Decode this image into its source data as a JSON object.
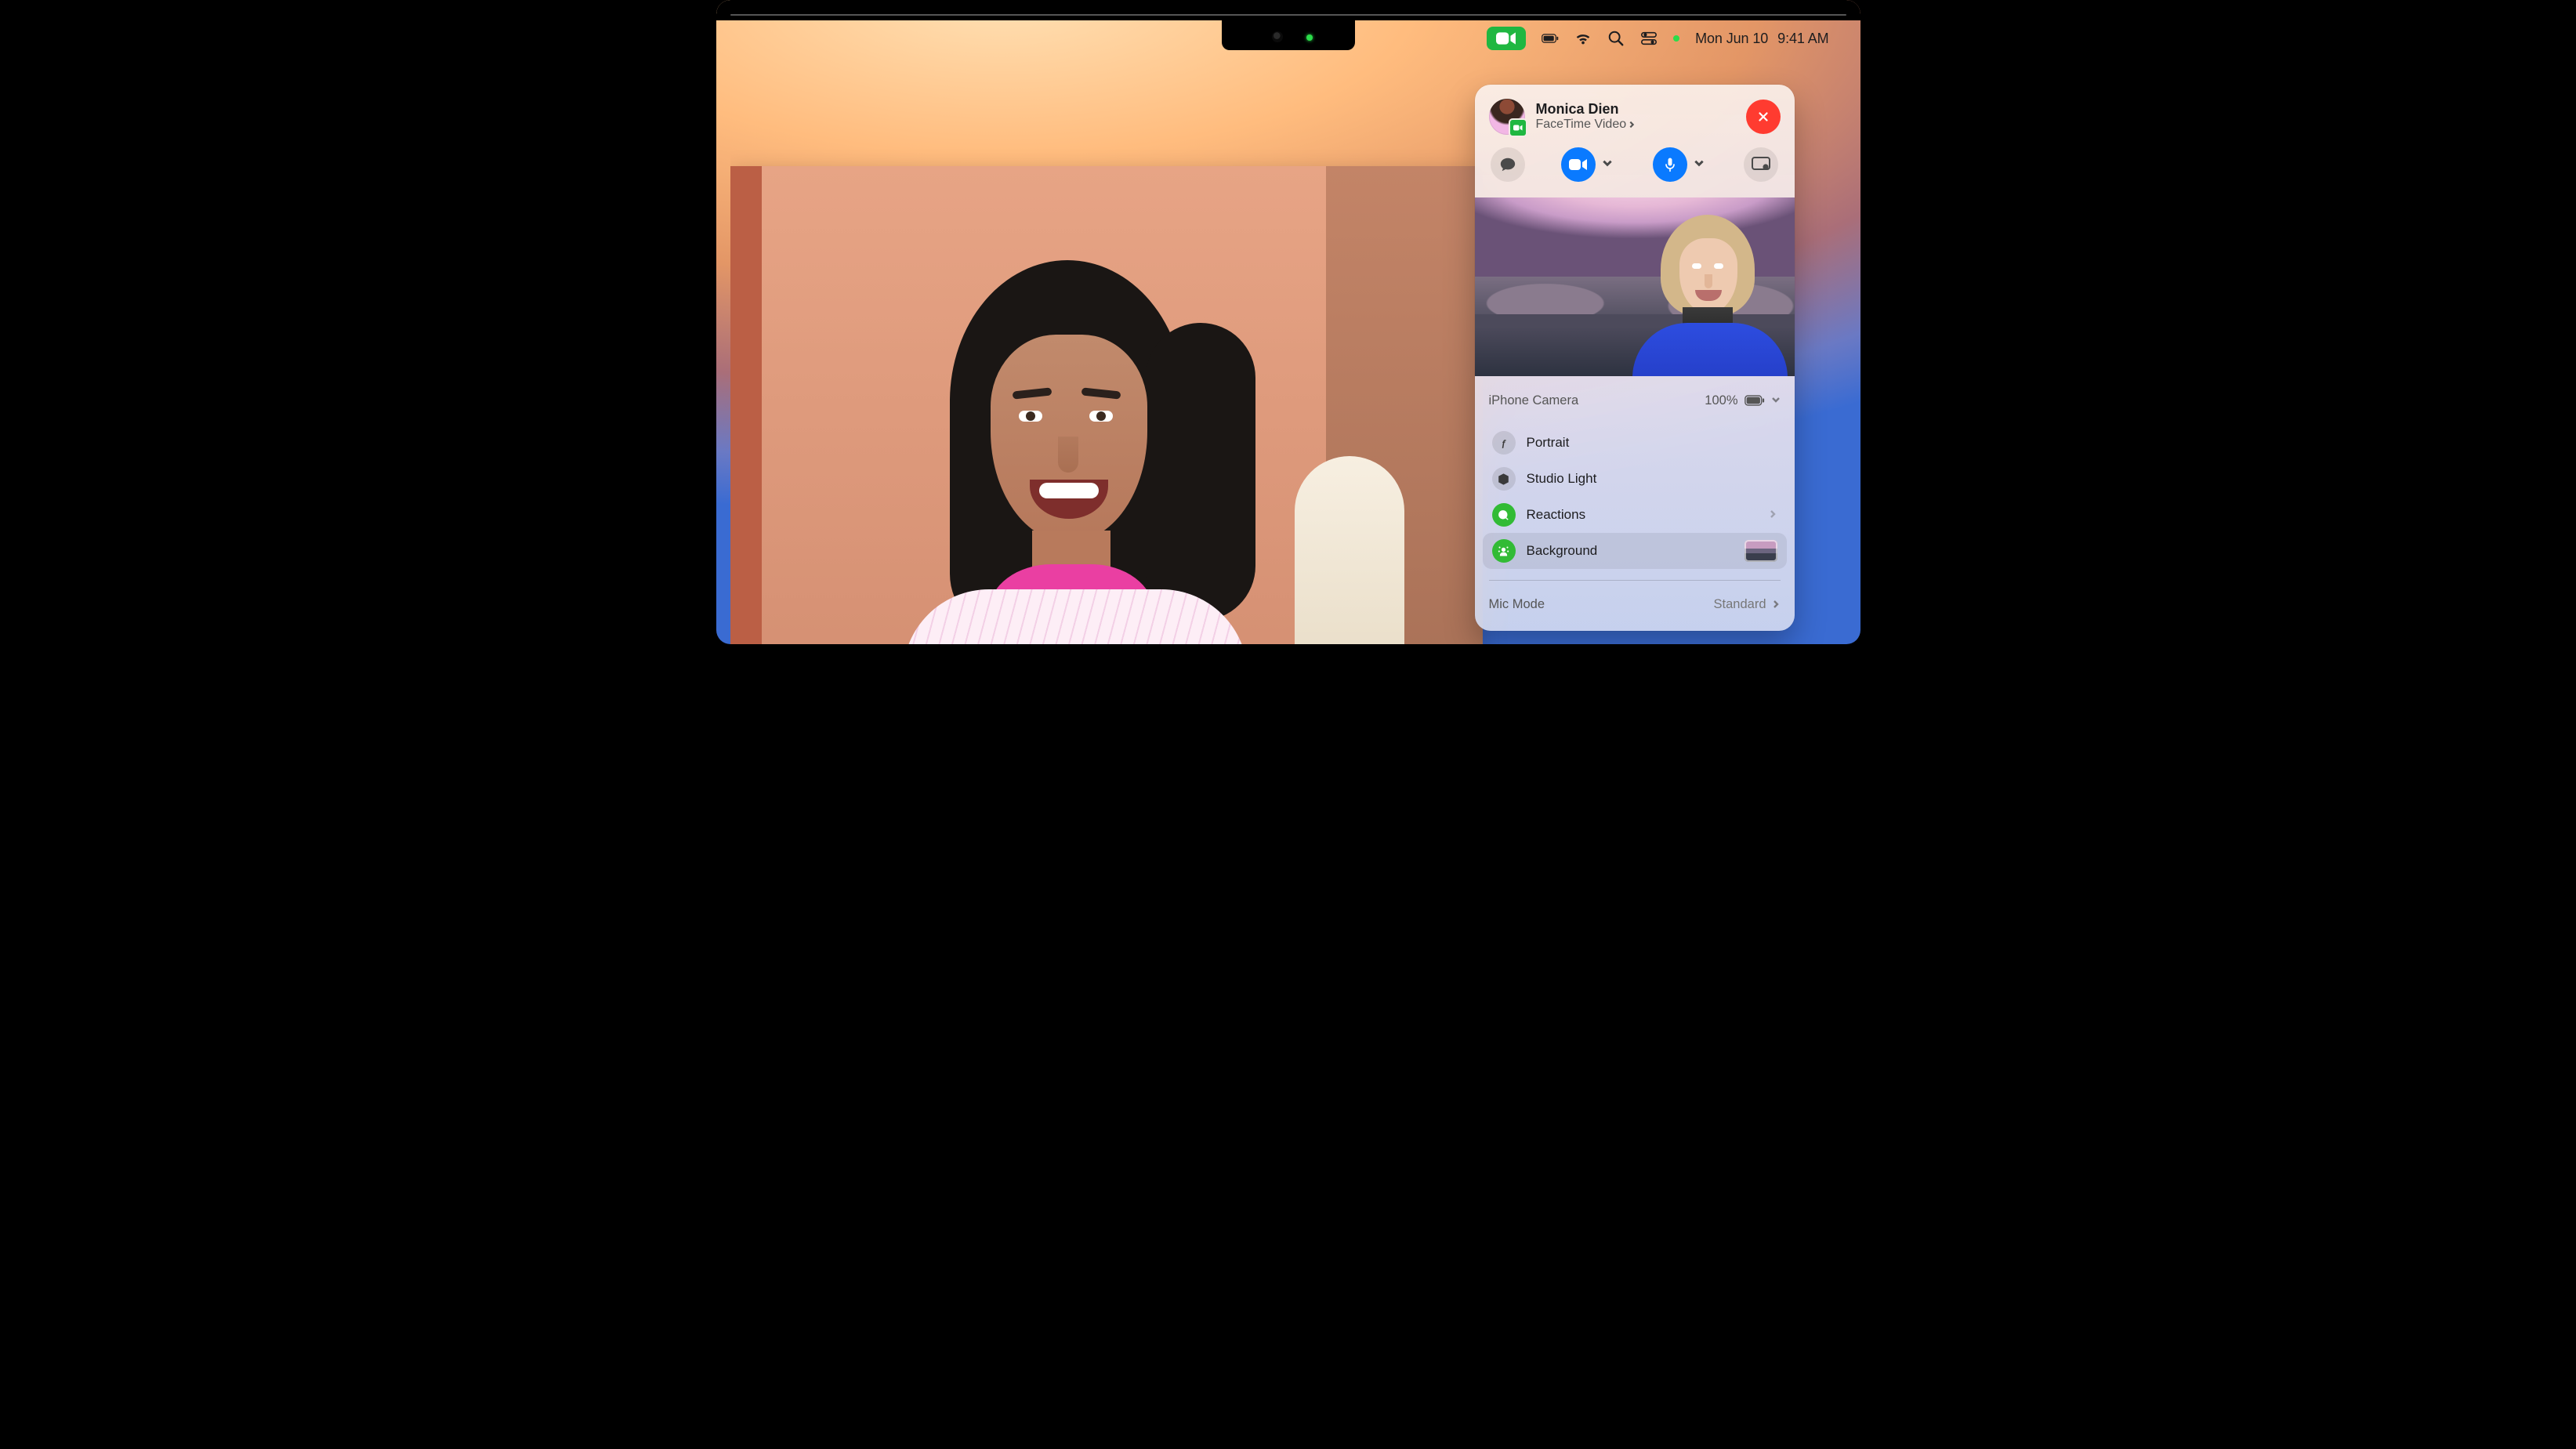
{
  "menubar": {
    "facetime_active": true,
    "date": "Mon Jun 10",
    "time": "9:41 AM"
  },
  "panel": {
    "header": {
      "contact_name": "Monica Dien",
      "call_type": "FaceTime Video"
    },
    "camera_source": {
      "label": "iPhone Camera",
      "battery_percent": "100%"
    },
    "options": {
      "portrait": "Portrait",
      "studio_light": "Studio Light",
      "reactions": "Reactions",
      "background": "Background"
    },
    "mic_mode": {
      "label": "Mic Mode",
      "value": "Standard"
    }
  }
}
